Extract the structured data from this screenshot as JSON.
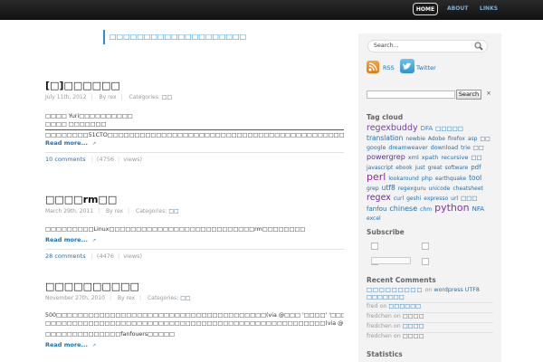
{
  "nav": {
    "home": "HOME",
    "about": "ABOUT",
    "links": "LINKS"
  },
  "tagline": "□□□□□□□□□□□□□□□□□□□□",
  "posts": [
    {
      "title": "[□]□□□□□□",
      "date": "July 11th, 2012",
      "by": "By rex",
      "categories_label": "Categories:",
      "category": "□□",
      "lines": [
        "□□□□ Yuri□□□□□□□□□□",
        "□□□□ □□□□□□□",
        "□□□□□□□□51CTO□□□□□□□□□□□□□□□□□□□□□□□□□□□□□□□□□□□□□□□□□□□□□□□□□□□□□□□□□□□□□□□□□□□□□□□□"
      ],
      "readmore": "Read more...",
      "comments": "10 comments",
      "views": "4756",
      "views_label": "views"
    },
    {
      "title": "□□□□rm□□",
      "date": "March 29th, 2011",
      "by": "By rex",
      "categories_label": "Categories:",
      "category": "□□",
      "lines": [
        "□□□□□□□□□Linux□□□□□□□□□□□□□□□□□□□□□□□□□□□rm□□□□□□□□"
      ],
      "readmore": "Read more...",
      "comments": "28 comments",
      "views": "4476",
      "views_label": "views"
    },
    {
      "title": "□□□□□□□□□□",
      "date": "November 27th, 2010",
      "by": "By rex",
      "categories_label": "Categories:",
      "category": "□□",
      "lines": [
        "500□□□□□□□□□□□□□□□□□□□□□□□□□□□□□□□□□□□□□□□(via @□□□ '□□□□' '□□□□□□□□□□□□□□' □□□□□□□□□□□□□□□□□□□□",
        "□□□□□□□□□□□□□□□□□□□□□□□□□□□□□□□□□□□□□□□□□□□□□□□□□□□□(via @□□□.exe)",
        "□□□□□□□□□□□□□□fanfouers□□□□□"
      ],
      "readmore": "Read more..."
    }
  ],
  "sidebar": {
    "search_placeholder": "Search...",
    "rss": "RSS",
    "twitter": "Twitter",
    "search_btn": "Search",
    "close": "×",
    "tagcloud_title": "Tag cloud",
    "tags": [
      {
        "t": "regexbuddy",
        "s": 9.5,
        "c": "#7a3fb3"
      },
      {
        "t": "DFA",
        "s": 7,
        "c": "#2a8fd8"
      },
      {
        "t": "□□□□□",
        "s": 6.5,
        "c": "#1f6fb2"
      },
      {
        "t": "translation",
        "s": 7.5,
        "c": "#1f6fb2"
      },
      {
        "t": "newbie",
        "s": 6,
        "c": "#1f6fb2"
      },
      {
        "t": "Adobe",
        "s": 6,
        "c": "#1f6fb2"
      },
      {
        "t": "firefox",
        "s": 6,
        "c": "#1f6fb2"
      },
      {
        "t": "asp",
        "s": 6,
        "c": "#1f6fb2"
      },
      {
        "t": "□□",
        "s": 6,
        "c": "#1f6fb2"
      },
      {
        "t": "google",
        "s": 6.3,
        "c": "#1f6fb2"
      },
      {
        "t": "dreamweaver",
        "s": 6.3,
        "c": "#1f6fb2"
      },
      {
        "t": "download",
        "s": 6.3,
        "c": "#1f6fb2"
      },
      {
        "t": "trie",
        "s": 6.3,
        "c": "#1f6fb2"
      },
      {
        "t": "□□",
        "s": 6.3,
        "c": "#1f6fb2"
      },
      {
        "t": "powergrep",
        "s": 8,
        "c": "#5a2f9a"
      },
      {
        "t": "xml",
        "s": 6.5,
        "c": "#1f6fb2"
      },
      {
        "t": "xpath",
        "s": 6.5,
        "c": "#1f6fb2"
      },
      {
        "t": "recursive",
        "s": 6.5,
        "c": "#1f6fb2"
      },
      {
        "t": "□□",
        "s": 6.5,
        "c": "#1f6fb2"
      },
      {
        "t": "javascript",
        "s": 6,
        "c": "#1f6fb2"
      },
      {
        "t": "ebook",
        "s": 6,
        "c": "#1f6fb2"
      },
      {
        "t": "just",
        "s": 6,
        "c": "#1f6fb2"
      },
      {
        "t": "great",
        "s": 6,
        "c": "#1f6fb2"
      },
      {
        "t": "software",
        "s": 6,
        "c": "#1f6fb2"
      },
      {
        "t": "pdf",
        "s": 7,
        "c": "#1f6fb2"
      },
      {
        "t": "perl",
        "s": 11,
        "c": "#8a2f9a"
      },
      {
        "t": "lookaround",
        "s": 6,
        "c": "#1f6fb2"
      },
      {
        "t": "php",
        "s": 6.3,
        "c": "#1f6fb2"
      },
      {
        "t": "earthquake",
        "s": 6,
        "c": "#1f6fb2"
      },
      {
        "t": "tool",
        "s": 7.5,
        "c": "#1f6fb2"
      },
      {
        "t": "grep",
        "s": 6,
        "c": "#1f6fb2"
      },
      {
        "t": "utf8",
        "s": 7.5,
        "c": "#1f6fb2"
      },
      {
        "t": "regexguru",
        "s": 6,
        "c": "#1f6fb2"
      },
      {
        "t": "unicode",
        "s": 6,
        "c": "#1f6fb2"
      },
      {
        "t": "cheatsheet",
        "s": 6,
        "c": "#1f6fb2"
      },
      {
        "t": "regex",
        "s": 9.5,
        "c": "#6a2f9a"
      },
      {
        "t": "curl",
        "s": 6,
        "c": "#1f6fb2"
      },
      {
        "t": "geshi",
        "s": 6,
        "c": "#1f6fb2"
      },
      {
        "t": "expresso",
        "s": 6,
        "c": "#1f6fb2"
      },
      {
        "t": "url",
        "s": 6,
        "c": "#1f6fb2"
      },
      {
        "t": "□□□",
        "s": 6.5,
        "c": "#1f6fb2"
      },
      {
        "t": "fanfou",
        "s": 7,
        "c": "#1f6fb2"
      },
      {
        "t": "chinese",
        "s": 8,
        "c": "#1f6fb2"
      },
      {
        "t": "chm",
        "s": 6,
        "c": "#1f6fb2"
      },
      {
        "t": "python",
        "s": 11,
        "c": "#8a2fb0"
      },
      {
        "t": "NFA",
        "s": 7,
        "c": "#1f6fb2"
      },
      {
        "t": "excel",
        "s": 6,
        "c": "#1f6fb2"
      }
    ],
    "subscribe_title": "Subscribe",
    "recent_title": "Recent Comments",
    "recent": [
      {
        "who": "□□□□□□□□□",
        "on": "on",
        "what": "wordpress UTF8 □□□□□□□"
      },
      {
        "who": "fred",
        "on": "on",
        "what": "□□□□□□"
      },
      {
        "who": "fredchen",
        "on": "on",
        "what": "□□□□"
      },
      {
        "who": "fredchen",
        "on": "on",
        "what": "□□□□"
      },
      {
        "who": "fredchen",
        "on": "on",
        "what": "□□□□"
      }
    ],
    "statistics_title": "Statistics"
  }
}
